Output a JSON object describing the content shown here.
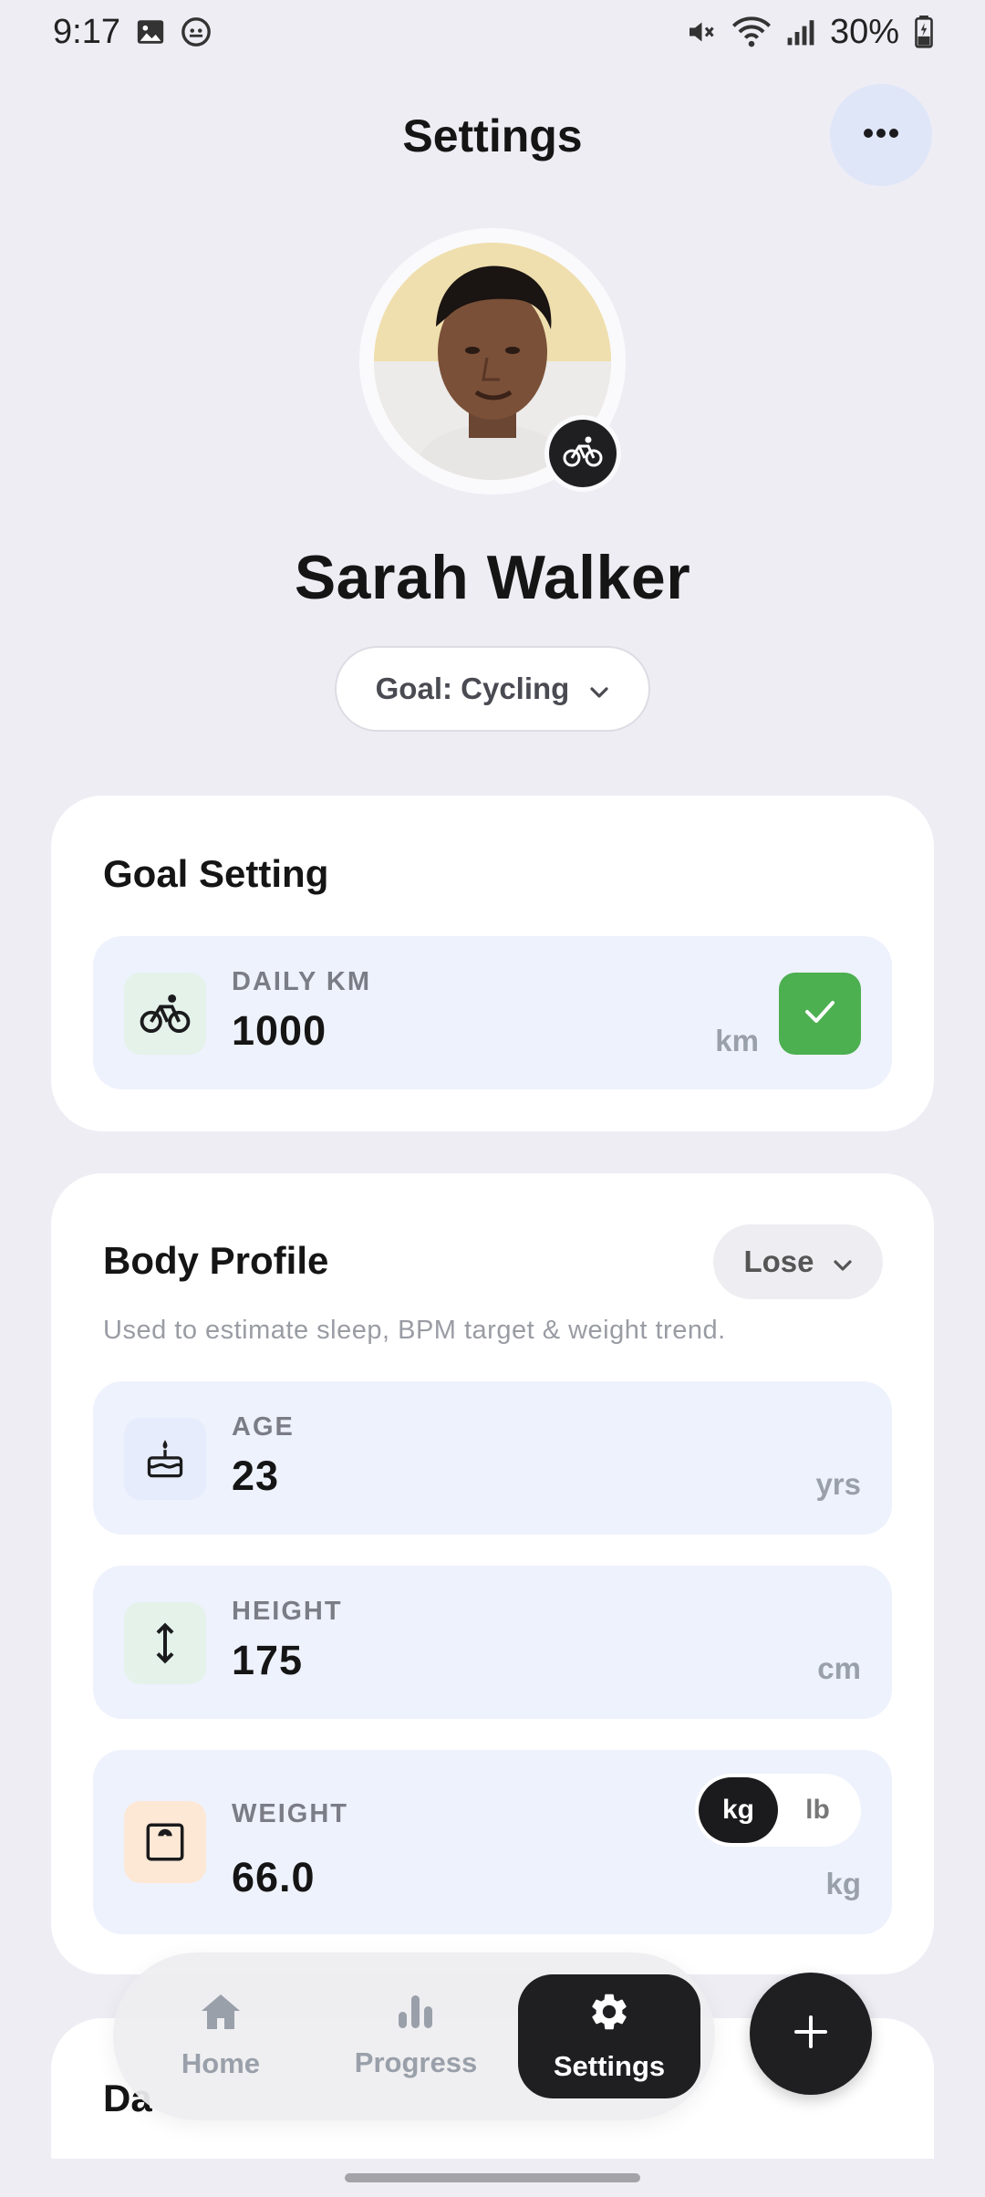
{
  "status_bar": {
    "time": "9:17",
    "battery": "30%",
    "icons": [
      "gallery-notification-icon",
      "android-notification-icon",
      "mute-icon",
      "wifi-icon",
      "signal-icon",
      "battery-icon"
    ]
  },
  "header": {
    "title": "Settings",
    "more_icon": "more-horizontal-icon"
  },
  "profile": {
    "name": "Sarah Walker",
    "badge_icon": "bicycle-icon",
    "goal_chip": "Goal: Cycling"
  },
  "goal_setting": {
    "title": "Goal Setting",
    "field": {
      "icon": "bicycle-icon",
      "label": "DAILY KM",
      "value": "1000",
      "unit": "km"
    }
  },
  "body_profile": {
    "title": "Body Profile",
    "mode": "Lose",
    "description": "Used to estimate sleep, BPM target & weight trend.",
    "age": {
      "icon": "cake-icon",
      "label": "AGE",
      "value": "23",
      "unit": "yrs"
    },
    "height": {
      "icon": "height-arrows-icon",
      "label": "HEIGHT",
      "value": "175",
      "unit": "cm"
    },
    "weight": {
      "icon": "scale-icon",
      "label": "WEIGHT",
      "value": "66.0",
      "unit": "kg",
      "unit_options": [
        "kg",
        "lb"
      ],
      "selected_unit": "kg"
    }
  },
  "partial_card": {
    "title_visible": "Da"
  },
  "bottom_nav": {
    "items": [
      {
        "label": "Home",
        "icon": "home-icon"
      },
      {
        "label": "Progress",
        "icon": "bar-chart-icon"
      },
      {
        "label": "Settings",
        "icon": "gear-icon"
      }
    ],
    "active": "Settings"
  },
  "fab": {
    "icon": "plus-icon"
  },
  "colors": {
    "background": "#efedf4",
    "card": "#ffffff",
    "field": "#eef2fd",
    "accent_dark": "#1f1f22",
    "confirm_green": "#4caf50",
    "muted_text": "#9aa0aa"
  }
}
